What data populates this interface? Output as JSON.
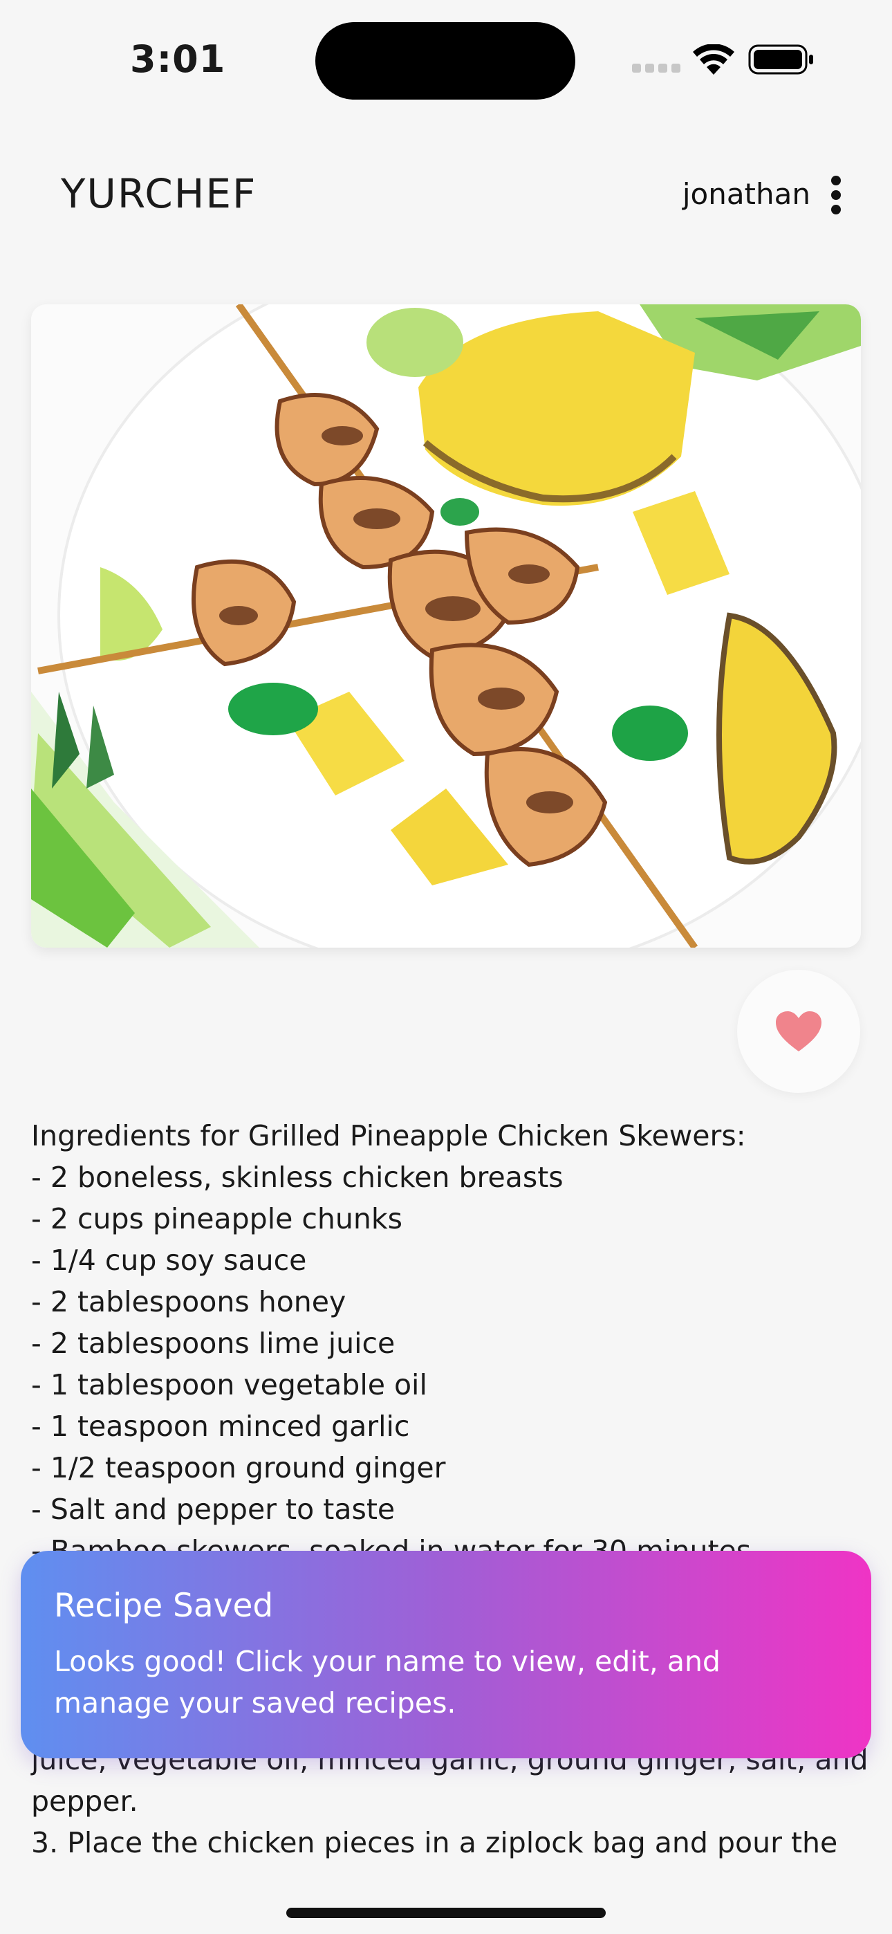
{
  "status_bar": {
    "time": "3:01"
  },
  "header": {
    "logo": "YURCHEF",
    "username": "jonathan"
  },
  "recipe": {
    "lines": [
      "Ingredients for Grilled Pineapple Chicken Skewers:",
      "- 2 boneless, skinless chicken breasts",
      "- 2 cups pineapple chunks",
      "- 1/4 cup soy sauce",
      "- 2 tablespoons honey",
      "- 2 tablespoons lime juice",
      "- 1 tablespoon vegetable oil",
      "- 1 teaspoon minced garlic",
      "- 1/2 teaspoon ground ginger",
      "- Salt and pepper to taste",
      "- Bamboo skewers, soaked in water for 30 minutes"
    ],
    "lines_below_toast": [
      "juice, vegetable oil, minced garlic, ground ginger, salt, and",
      "pepper.",
      "3. Place the chicken pieces in a ziplock bag and pour the"
    ]
  },
  "toast": {
    "title": "Recipe Saved",
    "message": "Looks good! Click your name to view, edit, and manage your saved recipes."
  },
  "colors": {
    "background": "#f6f6f6",
    "heart": "#f0848c",
    "toast_gradient_start": "#5f8ff0",
    "toast_gradient_end": "#ef34c5"
  },
  "icons": [
    "wifi-icon",
    "battery-icon",
    "more-vertical-icon",
    "heart-icon"
  ]
}
